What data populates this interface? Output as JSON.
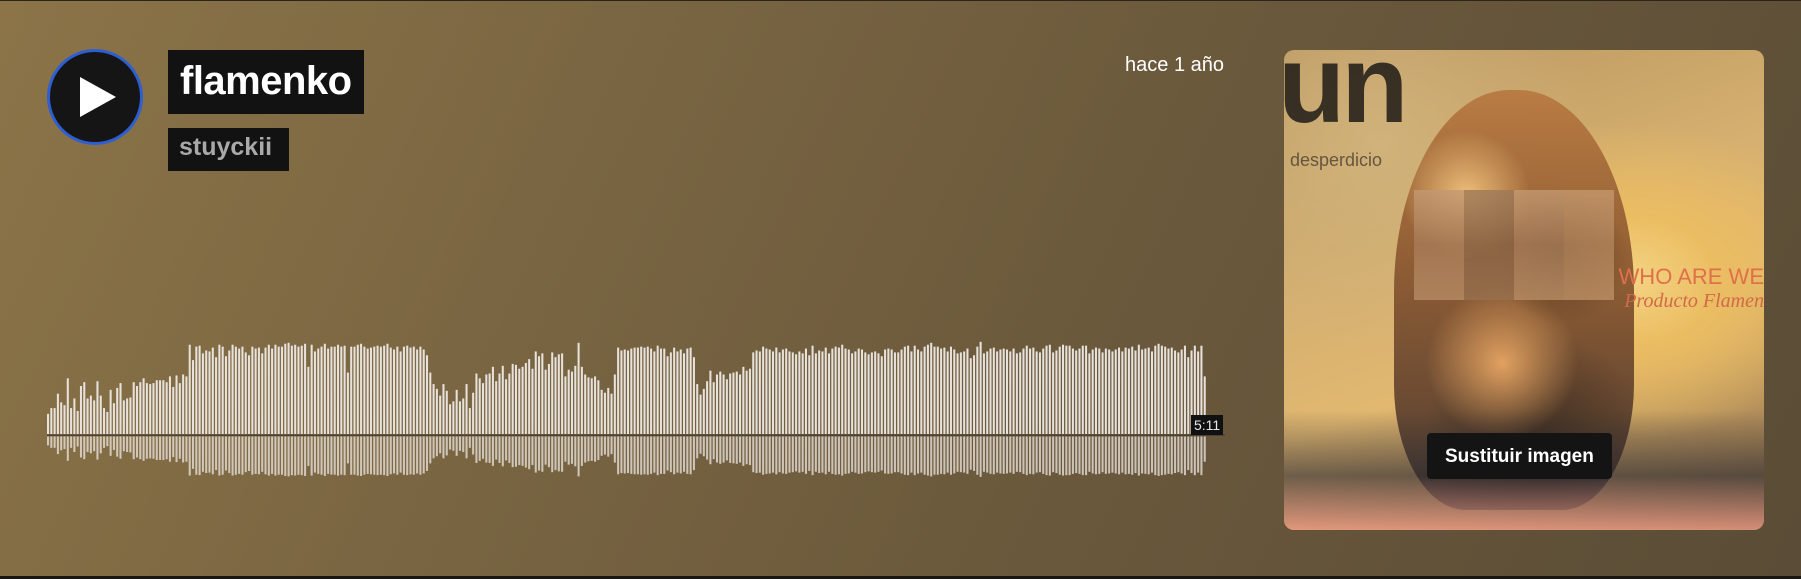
{
  "track": {
    "title": "flamenko",
    "artist": "stuyckii",
    "posted": "hace 1 año",
    "duration": "5:11"
  },
  "artwork": {
    "replace_button_label": "Sustituir imagen",
    "art_text_large": "un",
    "art_text_small": "desperdicio",
    "art_text_caption_1": "WHO ARE WE",
    "art_text_caption_2": "Producto Flamen"
  },
  "colors": {
    "background_start": "#8c7448",
    "background_end": "#5a4c36",
    "play_ring": "#2d5fd3",
    "waveform_bar": "#e8e2dc",
    "label_background": "#121212"
  },
  "icons": {
    "play": "play-triangle-icon"
  },
  "waveform": {
    "top_heights": [
      0.21,
      0.27,
      0.27,
      0.42,
      0.33,
      0.3,
      0.58,
      0.27,
      0.37,
      0.24,
      0.5,
      0.54,
      0.37,
      0.4,
      0.35,
      0.55,
      0.4,
      0.27,
      0.23,
      0.46,
      0.32,
      0.48,
      0.53,
      0.35,
      0.37,
      0.38,
      0.54,
      0.5,
      0.54,
      0.58,
      0.53,
      0.52,
      0.53,
      0.56,
      0.56,
      0.56,
      0.54,
      0.6,
      0.49,
      0.61,
      0.53,
      0.62,
      0.6,
      0.93,
      0.77,
      0.91,
      0.92,
      0.84,
      0.87,
      0.86,
      0.9,
      0.8,
      0.93,
      0.91,
      0.81,
      0.87,
      0.93,
      0.91,
      0.89,
      0.91,
      0.85,
      0.82,
      0.91,
      0.89,
      0.9,
      0.84,
      0.9,
      0.93,
      0.89,
      0.93,
      0.91,
      0.91,
      0.94,
      0.95,
      0.92,
      0.93,
      0.91,
      0.92,
      0.94,
      0.7,
      0.93,
      0.86,
      0.89,
      0.91,
      0.94,
      0.89,
      0.91,
      0.91,
      0.93,
      0.91,
      0.92,
      0.64,
      0.91,
      0.91,
      0.93,
      0.94,
      0.91,
      0.89,
      0.9,
      0.91,
      0.92,
      0.91,
      0.92,
      0.94,
      0.9,
      0.88,
      0.91,
      0.86,
      0.91,
      0.92,
      0.9,
      0.91,
      0.88,
      0.91,
      0.88,
      0.82,
      0.64,
      0.52,
      0.47,
      0.4,
      0.52,
      0.45,
      0.31,
      0.34,
      0.46,
      0.34,
      0.37,
      0.52,
      0.27,
      0.43,
      0.63,
      0.58,
      0.53,
      0.62,
      0.63,
      0.7,
      0.55,
      0.63,
      0.71,
      0.57,
      0.63,
      0.73,
      0.72,
      0.68,
      0.7,
      0.74,
      0.78,
      0.68,
      0.86,
      0.81,
      0.84,
      0.67,
      0.73,
      0.85,
      0.8,
      0.83,
      0.84,
      0.6,
      0.67,
      0.65,
      0.71,
      0.95,
      0.7,
      0.62,
      0.59,
      0.58,
      0.6,
      0.56,
      0.46,
      0.43,
      0.48,
      0.42,
      0.62,
      0.9,
      0.87,
      0.88,
      0.87,
      0.89,
      0.9,
      0.9,
      0.91,
      0.9,
      0.91,
      0.89,
      0.86,
      0.92,
      0.89,
      0.89,
      0.81,
      0.85,
      0.9,
      0.86,
      0.88,
      0.84,
      0.89,
      0.9,
      0.8,
      0.52,
      0.41,
      0.47,
      0.55,
      0.66,
      0.54,
      0.62,
      0.65,
      0.62,
      0.57,
      0.63,
      0.64,
      0.65,
      0.62,
      0.7,
      0.66,
      0.68,
      0.85,
      0.87,
      0.86,
      0.91,
      0.89,
      0.88,
      0.86,
      0.9,
      0.85,
      0.88,
      0.89,
      0.86,
      0.85,
      0.83,
      0.86,
      0.84,
      0.89,
      0.82,
      0.92,
      0.84,
      0.87,
      0.86,
      0.9,
      0.84,
      0.89,
      0.91,
      0.9,
      0.93,
      0.89,
      0.88,
      0.84,
      0.86,
      0.89,
      0.88,
      0.85,
      0.83,
      0.85,
      0.86,
      0.84,
      0.81,
      0.88,
      0.89,
      0.88,
      0.85,
      0.85,
      0.88,
      0.91,
      0.92,
      0.86,
      0.92,
      0.88,
      0.86,
      0.91,
      0.93,
      0.95,
      0.91,
      0.91,
      0.89,
      0.9,
      0.86,
      0.91,
      0.88,
      0.84,
      0.85,
      0.86,
      0.89,
      0.79,
      0.82,
      0.91,
      0.96,
      0.84,
      0.86,
      0.89,
      0.9,
      0.86,
      0.88,
      0.89,
      0.88,
      0.86,
      0.89,
      0.84,
      0.85,
      0.89,
      0.92,
      0.89,
      0.9,
      0.86,
      0.85,
      0.89,
      0.92,
      0.93,
      0.85,
      0.87,
      0.91,
      0.93,
      0.92,
      0.92,
      0.89,
      0.87,
      0.89,
      0.92,
      0.92,
      0.84,
      0.88,
      0.9,
      0.89,
      0.85,
      0.89,
      0.88,
      0.86,
      0.88,
      0.9,
      0.86,
      0.9,
      0.89,
      0.91,
      0.87,
      0.93,
      0.88,
      0.89,
      0.9,
      0.86,
      0.92,
      0.94,
      0.92,
      0.91,
      0.89,
      0.9,
      0.87,
      0.85,
      0.88,
      0.92,
      0.8,
      0.87,
      0.92,
      0.86,
      0.92,
      0.6
    ]
  }
}
